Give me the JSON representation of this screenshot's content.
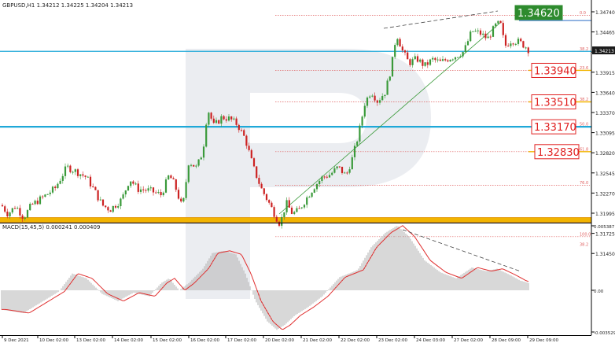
{
  "header": {
    "symbol_title": "GBPUSD,H1  1.34212 1.34225 1.34204 1.34213",
    "macd_title": "MACD(15,45,5) 0.000241 0.000409"
  },
  "price_axis": {
    "ticks": [
      "1.34740",
      "1.34465",
      "1.34190",
      "1.33915",
      "1.33640",
      "1.33370",
      "1.33095",
      "1.32820",
      "1.32545",
      "1.32270",
      "1.31995",
      "1.31725",
      "1.31450"
    ],
    "current_price": "1.34213"
  },
  "macd_axis": {
    "ticks": [
      "0.005387",
      "0.00",
      "-0.003529"
    ]
  },
  "time_axis": {
    "ticks": [
      "9 Dec 2021",
      "10 Dec 02:00",
      "13 Dec 02:00",
      "14 Dec 02:00",
      "15 Dec 02:00",
      "16 Dec 02:00",
      "17 Dec 02:00",
      "20 Dec 02:00",
      "21 Dec 02:00",
      "22 Dec 02:00",
      "23 Dec 02:00",
      "24 Dec 03:00",
      "27 Dec 02:00",
      "28 Dec 09:00",
      "29 Dec 09:00"
    ]
  },
  "fib_labels": [
    "0.0",
    "38.2",
    "23.6",
    "38.2",
    "50.0",
    "61.8",
    "76.0",
    "100.0",
    "38.2"
  ],
  "level_boxes": {
    "top": "1.34620",
    "l1": "1.33940",
    "l2": "1.33510",
    "l3": "1.33170",
    "l4": "1.32830"
  },
  "colors": {
    "bull": "#3a9a3a",
    "bear": "#cc2222",
    "fib": "#e06060",
    "cyan": "#1fa8d8",
    "gold": "#f2b400",
    "macd_signal": "#e03030",
    "macd_hist": "#b0b0b0",
    "box_green": "#2e8b2e",
    "box_red": "#e02020"
  },
  "chart_data": {
    "type": "candlestick",
    "symbol": "GBPUSD",
    "timeframe": "H1",
    "ohlc_last": {
      "open": 1.34212,
      "high": 1.34225,
      "low": 1.34204,
      "close": 1.34213
    },
    "ylim": [
      1.3145,
      1.3474
    ],
    "price_path": [
      [
        0,
        1.3213
      ],
      [
        10,
        1.3198
      ],
      [
        20,
        1.3209
      ],
      [
        30,
        1.3193
      ],
      [
        40,
        1.321
      ],
      [
        55,
        1.3221
      ],
      [
        70,
        1.3233
      ],
      [
        85,
        1.3262
      ],
      [
        95,
        1.3257
      ],
      [
        110,
        1.3248
      ],
      [
        120,
        1.323
      ],
      [
        130,
        1.321
      ],
      [
        140,
        1.3204
      ],
      [
        155,
        1.3218
      ],
      [
        165,
        1.3246
      ],
      [
        175,
        1.3232
      ],
      [
        190,
        1.323
      ],
      [
        205,
        1.3224
      ],
      [
        215,
        1.3251
      ],
      [
        222,
        1.3238
      ],
      [
        232,
        1.3205
      ],
      [
        240,
        1.327
      ],
      [
        250,
        1.3261
      ],
      [
        258,
        1.3284
      ],
      [
        264,
        1.3342
      ],
      [
        272,
        1.3318
      ],
      [
        282,
        1.333
      ],
      [
        292,
        1.3328
      ],
      [
        302,
        1.332
      ],
      [
        312,
        1.33
      ],
      [
        322,
        1.3262
      ],
      [
        332,
        1.3233
      ],
      [
        342,
        1.3213
      ],
      [
        350,
        1.3196
      ],
      [
        356,
        1.3184
      ],
      [
        364,
        1.3213
      ],
      [
        372,
        1.3198
      ],
      [
        380,
        1.3203
      ],
      [
        390,
        1.322
      ],
      [
        400,
        1.3236
      ],
      [
        410,
        1.3248
      ],
      [
        420,
        1.3252
      ],
      [
        430,
        1.3262
      ],
      [
        440,
        1.325
      ],
      [
        448,
        1.3274
      ],
      [
        456,
        1.3307
      ],
      [
        464,
        1.335
      ],
      [
        472,
        1.3366
      ],
      [
        480,
        1.3352
      ],
      [
        490,
        1.3365
      ],
      [
        498,
        1.34
      ],
      [
        504,
        1.3445
      ],
      [
        512,
        1.342
      ],
      [
        520,
        1.3404
      ],
      [
        530,
        1.341
      ],
      [
        540,
        1.34
      ],
      [
        550,
        1.3409
      ],
      [
        560,
        1.3405
      ],
      [
        570,
        1.341
      ],
      [
        580,
        1.3414
      ],
      [
        590,
        1.342
      ],
      [
        600,
        1.3448
      ],
      [
        610,
        1.3445
      ],
      [
        620,
        1.3437
      ],
      [
        630,
        1.3455
      ],
      [
        636,
        1.3459
      ],
      [
        642,
        1.3427
      ],
      [
        650,
        1.3435
      ],
      [
        660,
        1.3433
      ],
      [
        668,
        1.3427
      ],
      [
        673,
        1.3421
      ]
    ],
    "fibonacci_levels": [
      {
        "ratio": "0.0",
        "price": 1.3469
      },
      {
        "ratio": "23.6",
        "price": 1.3394
      },
      {
        "ratio": "38.2",
        "price": 1.3351
      },
      {
        "ratio": "50.0",
        "price": 1.3317
      },
      {
        "ratio": "61.8",
        "price": 1.3283
      },
      {
        "ratio": "76.0",
        "price": 1.3237
      },
      {
        "ratio": "100.0",
        "price": 1.3167
      },
      {
        "ratio": "38.2 (upper range)",
        "price": 1.342
      }
    ],
    "key_levels": [
      1.3462,
      1.3394,
      1.3351,
      1.3317,
      1.3283
    ],
    "macd": {
      "params": "15,45,5",
      "main": 0.000241,
      "signal": 0.000409,
      "ylim": [
        -0.003529,
        0.005387
      ]
    }
  }
}
